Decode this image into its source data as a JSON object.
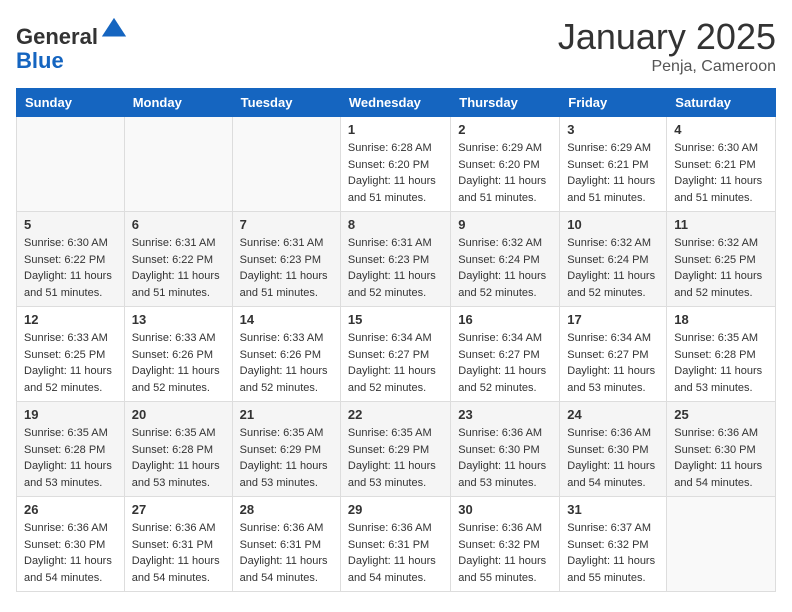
{
  "header": {
    "logo_line1": "General",
    "logo_line2": "Blue",
    "month": "January 2025",
    "location": "Penja, Cameroon"
  },
  "days_of_week": [
    "Sunday",
    "Monday",
    "Tuesday",
    "Wednesday",
    "Thursday",
    "Friday",
    "Saturday"
  ],
  "weeks": [
    [
      {
        "day": "",
        "info": ""
      },
      {
        "day": "",
        "info": ""
      },
      {
        "day": "",
        "info": ""
      },
      {
        "day": "1",
        "info": "Sunrise: 6:28 AM\nSunset: 6:20 PM\nDaylight: 11 hours and 51 minutes."
      },
      {
        "day": "2",
        "info": "Sunrise: 6:29 AM\nSunset: 6:20 PM\nDaylight: 11 hours and 51 minutes."
      },
      {
        "day": "3",
        "info": "Sunrise: 6:29 AM\nSunset: 6:21 PM\nDaylight: 11 hours and 51 minutes."
      },
      {
        "day": "4",
        "info": "Sunrise: 6:30 AM\nSunset: 6:21 PM\nDaylight: 11 hours and 51 minutes."
      }
    ],
    [
      {
        "day": "5",
        "info": "Sunrise: 6:30 AM\nSunset: 6:22 PM\nDaylight: 11 hours and 51 minutes."
      },
      {
        "day": "6",
        "info": "Sunrise: 6:31 AM\nSunset: 6:22 PM\nDaylight: 11 hours and 51 minutes."
      },
      {
        "day": "7",
        "info": "Sunrise: 6:31 AM\nSunset: 6:23 PM\nDaylight: 11 hours and 51 minutes."
      },
      {
        "day": "8",
        "info": "Sunrise: 6:31 AM\nSunset: 6:23 PM\nDaylight: 11 hours and 52 minutes."
      },
      {
        "day": "9",
        "info": "Sunrise: 6:32 AM\nSunset: 6:24 PM\nDaylight: 11 hours and 52 minutes."
      },
      {
        "day": "10",
        "info": "Sunrise: 6:32 AM\nSunset: 6:24 PM\nDaylight: 11 hours and 52 minutes."
      },
      {
        "day": "11",
        "info": "Sunrise: 6:32 AM\nSunset: 6:25 PM\nDaylight: 11 hours and 52 minutes."
      }
    ],
    [
      {
        "day": "12",
        "info": "Sunrise: 6:33 AM\nSunset: 6:25 PM\nDaylight: 11 hours and 52 minutes."
      },
      {
        "day": "13",
        "info": "Sunrise: 6:33 AM\nSunset: 6:26 PM\nDaylight: 11 hours and 52 minutes."
      },
      {
        "day": "14",
        "info": "Sunrise: 6:33 AM\nSunset: 6:26 PM\nDaylight: 11 hours and 52 minutes."
      },
      {
        "day": "15",
        "info": "Sunrise: 6:34 AM\nSunset: 6:27 PM\nDaylight: 11 hours and 52 minutes."
      },
      {
        "day": "16",
        "info": "Sunrise: 6:34 AM\nSunset: 6:27 PM\nDaylight: 11 hours and 52 minutes."
      },
      {
        "day": "17",
        "info": "Sunrise: 6:34 AM\nSunset: 6:27 PM\nDaylight: 11 hours and 53 minutes."
      },
      {
        "day": "18",
        "info": "Sunrise: 6:35 AM\nSunset: 6:28 PM\nDaylight: 11 hours and 53 minutes."
      }
    ],
    [
      {
        "day": "19",
        "info": "Sunrise: 6:35 AM\nSunset: 6:28 PM\nDaylight: 11 hours and 53 minutes."
      },
      {
        "day": "20",
        "info": "Sunrise: 6:35 AM\nSunset: 6:28 PM\nDaylight: 11 hours and 53 minutes."
      },
      {
        "day": "21",
        "info": "Sunrise: 6:35 AM\nSunset: 6:29 PM\nDaylight: 11 hours and 53 minutes."
      },
      {
        "day": "22",
        "info": "Sunrise: 6:35 AM\nSunset: 6:29 PM\nDaylight: 11 hours and 53 minutes."
      },
      {
        "day": "23",
        "info": "Sunrise: 6:36 AM\nSunset: 6:30 PM\nDaylight: 11 hours and 53 minutes."
      },
      {
        "day": "24",
        "info": "Sunrise: 6:36 AM\nSunset: 6:30 PM\nDaylight: 11 hours and 54 minutes."
      },
      {
        "day": "25",
        "info": "Sunrise: 6:36 AM\nSunset: 6:30 PM\nDaylight: 11 hours and 54 minutes."
      }
    ],
    [
      {
        "day": "26",
        "info": "Sunrise: 6:36 AM\nSunset: 6:30 PM\nDaylight: 11 hours and 54 minutes."
      },
      {
        "day": "27",
        "info": "Sunrise: 6:36 AM\nSunset: 6:31 PM\nDaylight: 11 hours and 54 minutes."
      },
      {
        "day": "28",
        "info": "Sunrise: 6:36 AM\nSunset: 6:31 PM\nDaylight: 11 hours and 54 minutes."
      },
      {
        "day": "29",
        "info": "Sunrise: 6:36 AM\nSunset: 6:31 PM\nDaylight: 11 hours and 54 minutes."
      },
      {
        "day": "30",
        "info": "Sunrise: 6:36 AM\nSunset: 6:32 PM\nDaylight: 11 hours and 55 minutes."
      },
      {
        "day": "31",
        "info": "Sunrise: 6:37 AM\nSunset: 6:32 PM\nDaylight: 11 hours and 55 minutes."
      },
      {
        "day": "",
        "info": ""
      }
    ]
  ]
}
